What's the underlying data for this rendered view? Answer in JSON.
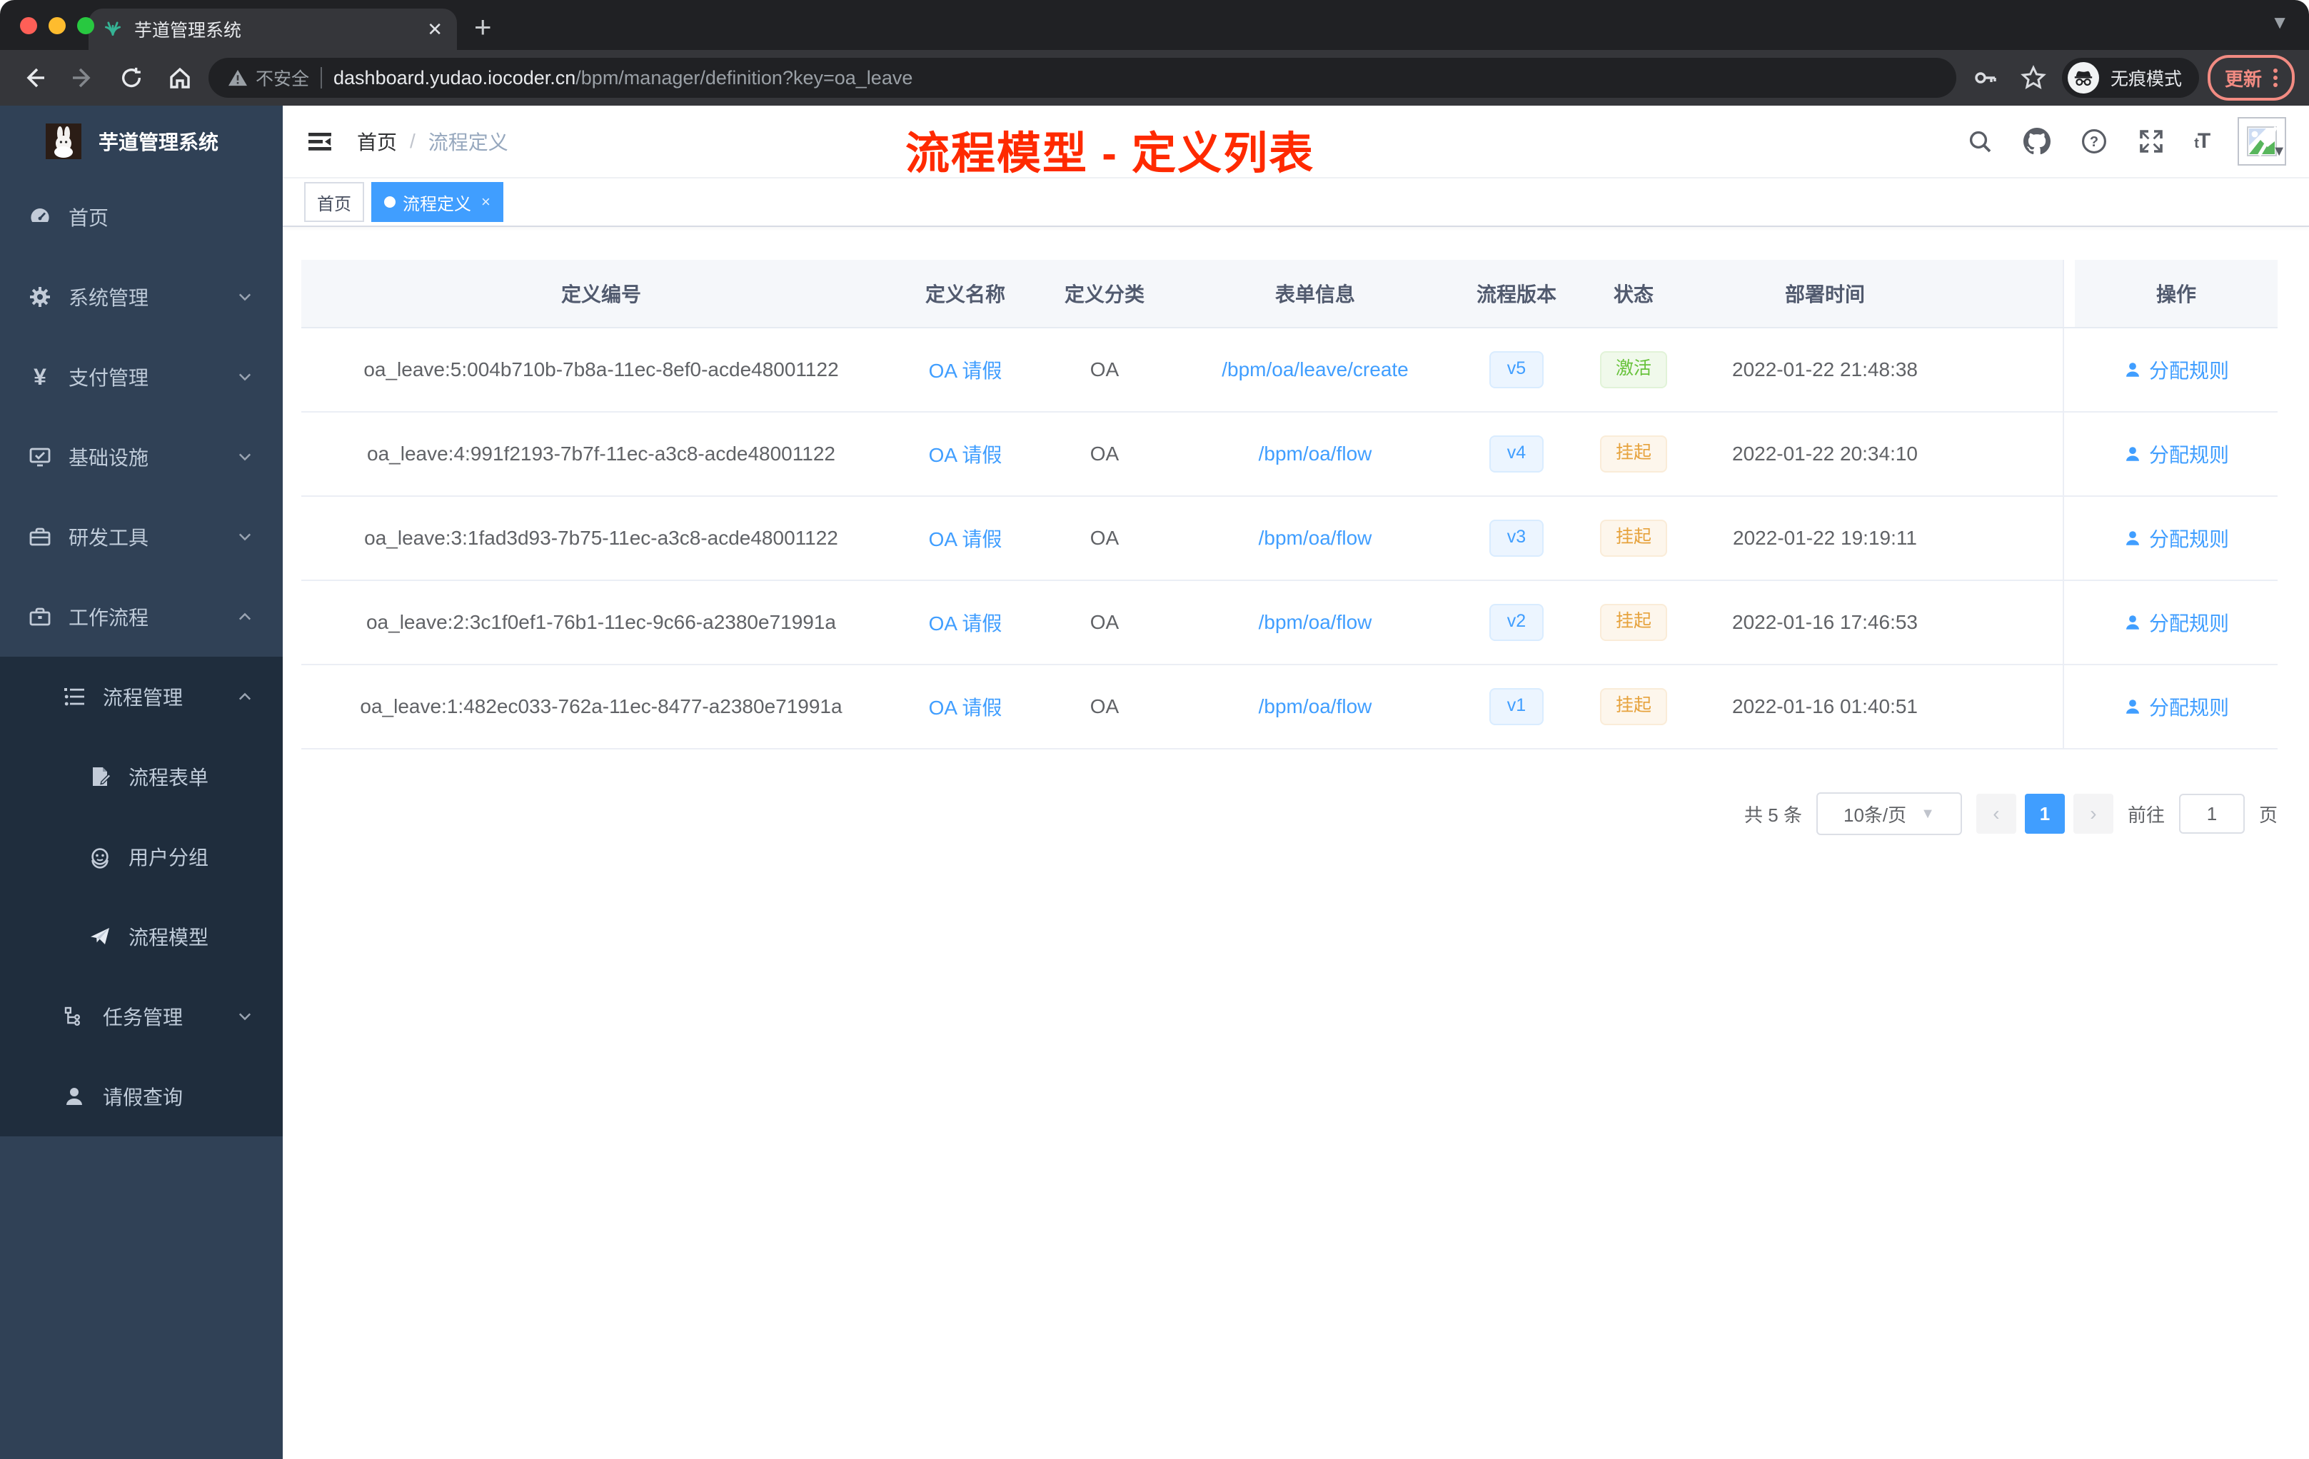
{
  "browser": {
    "tab_title": "芋道管理系统",
    "close_glyph": "✕",
    "security_label": "不安全",
    "url_host": "dashboard.yudao.iocoder.cn",
    "url_path": "/bpm/manager/definition?key=oa_leave",
    "incognito_label": "无痕模式",
    "update_label": "更新"
  },
  "sidebar": {
    "app_title": "芋道管理系统",
    "items": [
      {
        "label": "首页"
      },
      {
        "label": "系统管理"
      },
      {
        "label": "支付管理"
      },
      {
        "label": "基础设施"
      },
      {
        "label": "研发工具"
      },
      {
        "label": "工作流程"
      },
      {
        "label": "流程管理"
      },
      {
        "label": "流程表单"
      },
      {
        "label": "用户分组"
      },
      {
        "label": "流程模型"
      },
      {
        "label": "任务管理"
      },
      {
        "label": "请假查询"
      }
    ]
  },
  "navbar": {
    "breadcrumb": {
      "home": "首页",
      "separator": "/",
      "current": "流程定义"
    }
  },
  "annotation": {
    "text": "流程模型 - 定义列表",
    "color": "#ff2a00"
  },
  "tags": {
    "home": {
      "label": "首页"
    },
    "current": {
      "label": "流程定义",
      "close_glyph": "×"
    }
  },
  "table": {
    "columns": {
      "id": "定义编号",
      "name": "定义名称",
      "category": "定义分类",
      "form": "表单信息",
      "version": "流程版本",
      "status": "状态",
      "deploy_time": "部署时间",
      "actions": "操作"
    },
    "rows": [
      {
        "id": "oa_leave:5:004b710b-7b8a-11ec-8ef0-acde48001122",
        "name": "OA 请假",
        "category": "OA",
        "form": "/bpm/oa/leave/create",
        "version": "v5",
        "status": "激活",
        "status_type": "success",
        "deploy_time": "2022-01-22 21:48:38",
        "action": "分配规则"
      },
      {
        "id": "oa_leave:4:991f2193-7b7f-11ec-a3c8-acde48001122",
        "name": "OA 请假",
        "category": "OA",
        "form": "/bpm/oa/flow",
        "version": "v4",
        "status": "挂起",
        "status_type": "warning",
        "deploy_time": "2022-01-22 20:34:10",
        "action": "分配规则"
      },
      {
        "id": "oa_leave:3:1fad3d93-7b75-11ec-a3c8-acde48001122",
        "name": "OA 请假",
        "category": "OA",
        "form": "/bpm/oa/flow",
        "version": "v3",
        "status": "挂起",
        "status_type": "warning",
        "deploy_time": "2022-01-22 19:19:11",
        "action": "分配规则"
      },
      {
        "id": "oa_leave:2:3c1f0ef1-76b1-11ec-9c66-a2380e71991a",
        "name": "OA 请假",
        "category": "OA",
        "form": "/bpm/oa/flow",
        "version": "v2",
        "status": "挂起",
        "status_type": "warning",
        "deploy_time": "2022-01-16 17:46:53",
        "action": "分配规则"
      },
      {
        "id": "oa_leave:1:482ec033-762a-11ec-8477-a2380e71991a",
        "name": "OA 请假",
        "category": "OA",
        "form": "/bpm/oa/flow",
        "version": "v1",
        "status": "挂起",
        "status_type": "warning",
        "deploy_time": "2022-01-16 01:40:51",
        "action": "分配规则"
      }
    ]
  },
  "pagination": {
    "total_label": "共 5 条",
    "page_size": "10条/页",
    "prev_glyph": "‹",
    "current_page": "1",
    "next_glyph": "›",
    "goto_label": "前往",
    "goto_value": "1",
    "page_unit": "页"
  },
  "colors": {
    "accent": "#409eff",
    "sidebar_bg": "#304156",
    "submenu_bg": "#1f2d3d",
    "status_active": "#67c23a",
    "status_suspended": "#e6a23c",
    "annotation_red": "#ff2a00",
    "update_red": "#f28b82"
  }
}
